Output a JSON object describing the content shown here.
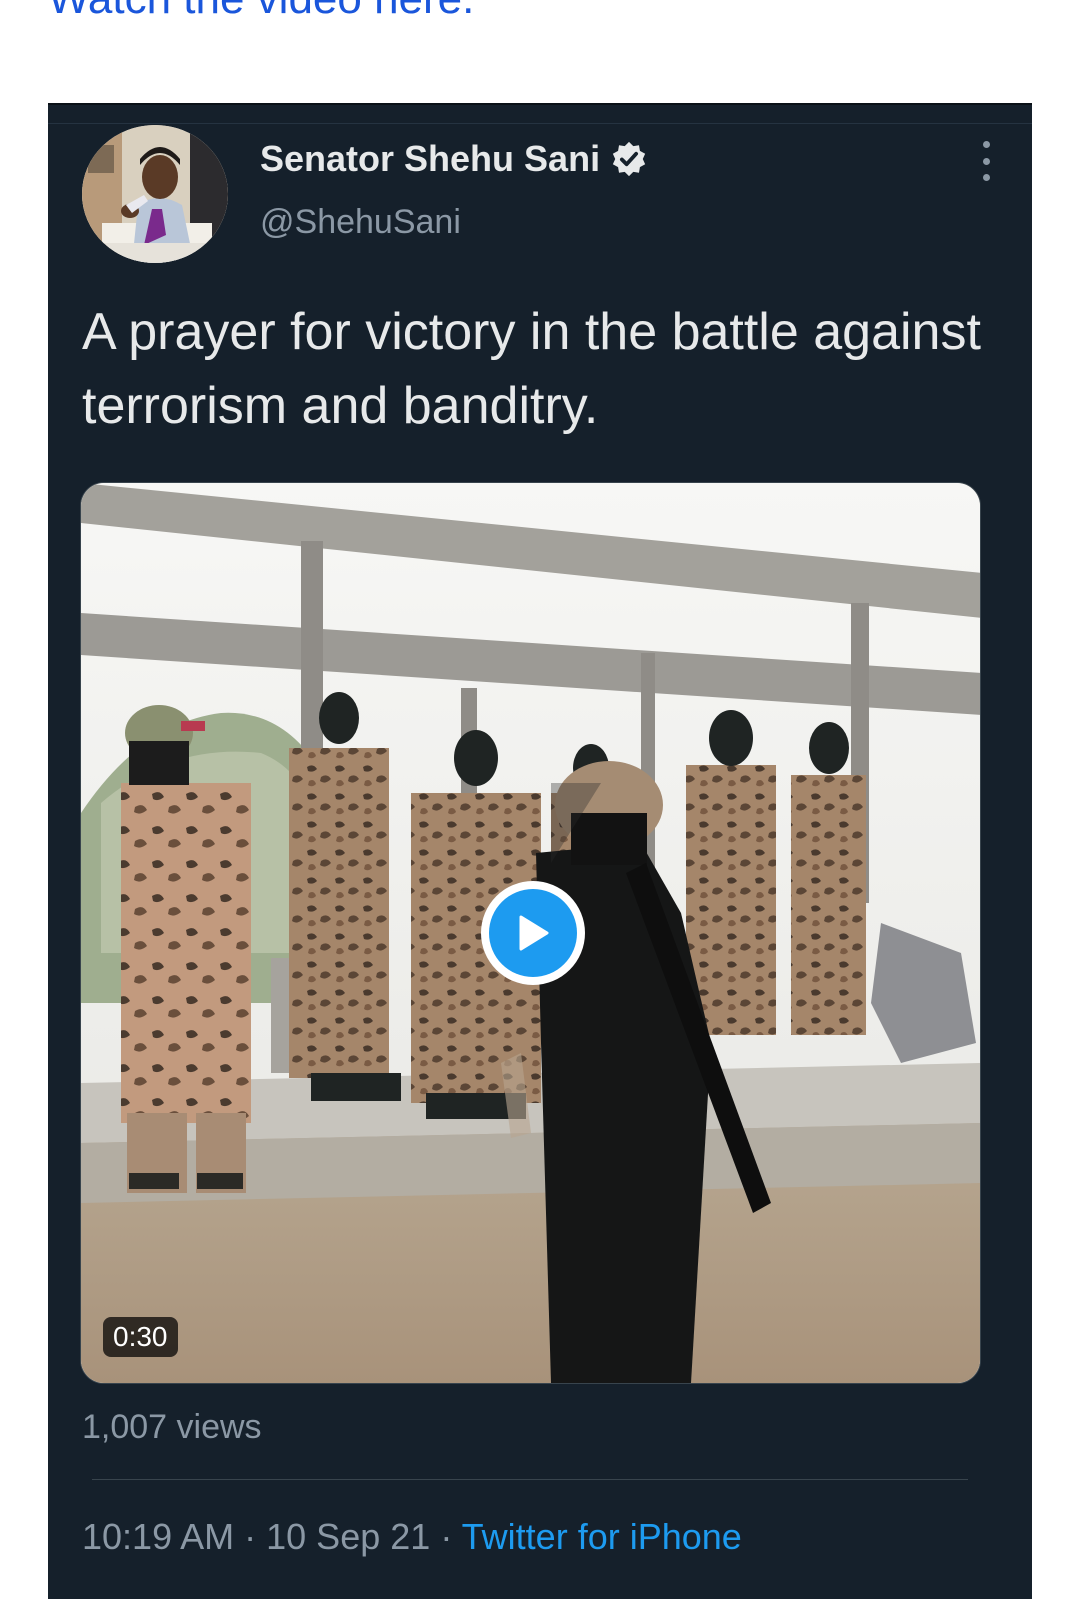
{
  "article": {
    "link_text": "Watch the video here."
  },
  "tweet": {
    "author": {
      "display_name": "Senator Shehu Sani",
      "handle": "@ShehuSani",
      "verified": true
    },
    "text": "A prayer for victory in the battle against terrorism and banditry.",
    "media": {
      "type": "video",
      "duration": "0:30"
    },
    "views": "1,007 views",
    "time": "10:19 AM",
    "separator": "·",
    "date": "10 Sep 21",
    "source": "Twitter for iPhone"
  },
  "icons": {
    "verified": "verified-badge-icon",
    "more": "more-options-icon",
    "play": "play-icon"
  },
  "colors": {
    "card_background": "#15202b",
    "primary_text": "#e7e9ea",
    "secondary_text": "#8b98a5",
    "accent": "#1d9bf0",
    "link": "#1a56db"
  }
}
